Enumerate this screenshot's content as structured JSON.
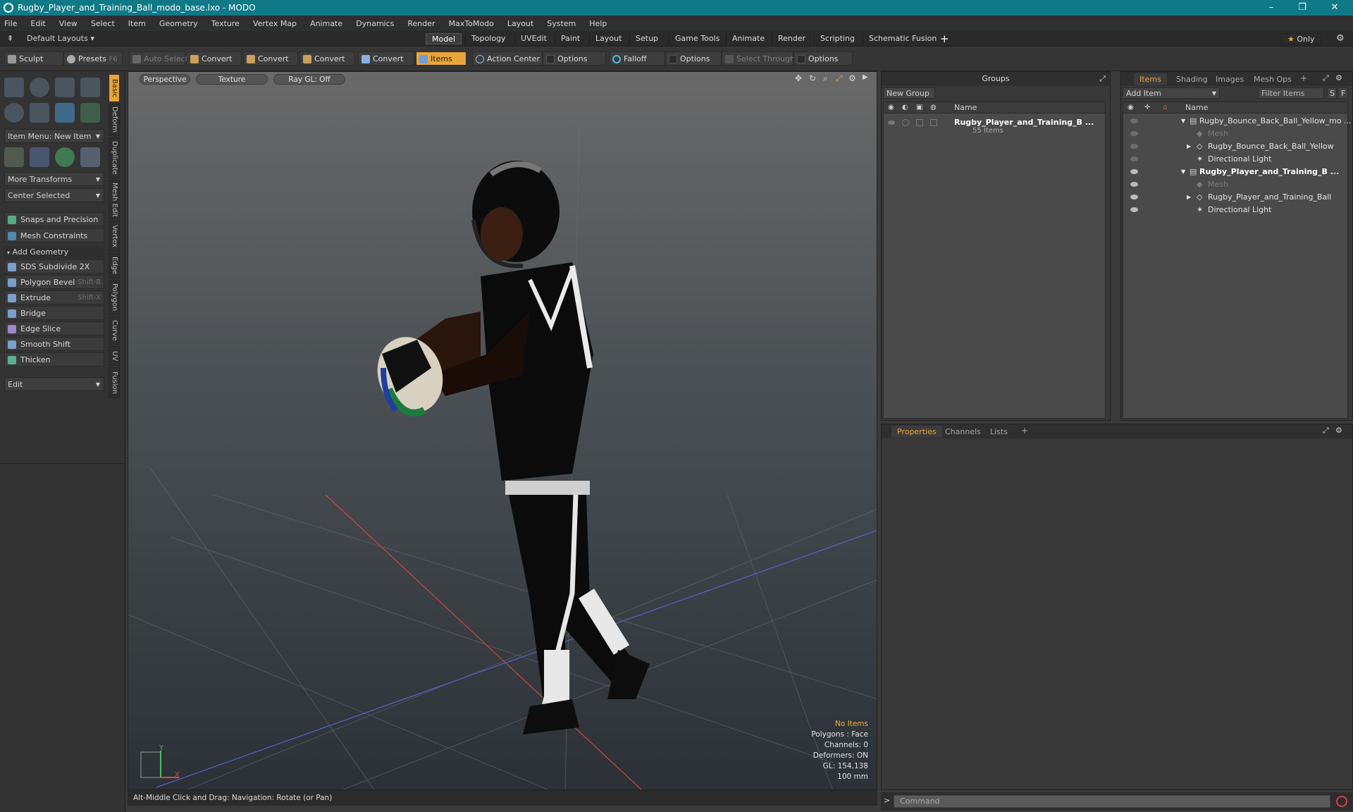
{
  "window": {
    "title": "Rugby_Player_and_Training_Ball_modo_base.lxo - MODO",
    "controls": [
      "–",
      "❐",
      "✕"
    ]
  },
  "menu": [
    "File",
    "Edit",
    "View",
    "Select",
    "Item",
    "Geometry",
    "Texture",
    "Vertex Map",
    "Animate",
    "Dynamics",
    "Render",
    "MaxToModo",
    "Layout",
    "System",
    "Help"
  ],
  "layout_row": {
    "layout_name": "Default Layouts",
    "tabs": [
      "Model",
      "Topology",
      "UVEdit",
      "Paint",
      "Layout",
      "Setup",
      "Game Tools",
      "Animate",
      "Render",
      "Scripting",
      "Schematic Fusion"
    ],
    "active_tab": "Model",
    "add": "+",
    "only": "Only"
  },
  "toolbar": {
    "sculpt": "Sculpt",
    "presets": "Presets",
    "presets_key": "F6",
    "auto_select": "Auto Select",
    "convert1": "Convert",
    "convert2": "Convert",
    "convert3": "Convert",
    "convert4": "Convert",
    "items": "Items",
    "action_center": "Action Center",
    "options1": "Options",
    "falloff": "Falloff",
    "options2": "Options",
    "select_through": "Select Through",
    "options3": "Options"
  },
  "left_panel": {
    "item_menu": "Item Menu: New Item",
    "more_transforms": "More Transforms",
    "center_selected": "Center Selected",
    "snaps": "Snaps and Precision",
    "mesh_constraints": "Mesh Constraints",
    "add_geometry": "Add Geometry",
    "tools": [
      {
        "label": "SDS Subdivide 2X",
        "key": ""
      },
      {
        "label": "Polygon Bevel",
        "key": "Shift-B"
      },
      {
        "label": "Extrude",
        "key": "Shift-X"
      },
      {
        "label": "Bridge",
        "key": ""
      },
      {
        "label": "Edge Slice",
        "key": ""
      },
      {
        "label": "Smooth Shift",
        "key": ""
      },
      {
        "label": "Thicken",
        "key": ""
      }
    ],
    "edit": "Edit",
    "vtabs": [
      "Basic",
      "Deform",
      "Duplicate",
      "Mesh Edit",
      "Vertex",
      "Edge",
      "Polygon",
      "Curve",
      "UV",
      "Fusion"
    ]
  },
  "viewport": {
    "perspective": "Perspective",
    "texture": "Texture",
    "raygl": "Ray GL: Off",
    "info": {
      "no_items": "No Items",
      "polygons": "Polygons : Face",
      "channels": "Channels: 0",
      "deformers": "Deformers: ON",
      "gl": "GL: 154,138",
      "scale": "100 mm"
    },
    "status": "Alt-Middle Click and Drag:   Navigation: Rotate (or Pan)"
  },
  "groups_panel": {
    "title": "Groups",
    "new_group": "New Group",
    "name_col": "Name",
    "group_name": "Rugby_Player_and_Training_B ...",
    "group_count": "55 Items"
  },
  "items_panel": {
    "tabs": [
      "Items",
      "Shading",
      "Images",
      "Mesh Ops"
    ],
    "active_tab": "Items",
    "add_item": "Add Item",
    "filter": "Filter Items",
    "s": "S",
    "f": "F",
    "name_col": "Name",
    "rows": [
      {
        "label": "Rugby_Bounce_Back_Ball_Yellow_mo ...",
        "style": "normal",
        "indent": 0
      },
      {
        "label": "Mesh",
        "style": "dim",
        "indent": 1
      },
      {
        "label": "Rugby_Bounce_Back_Ball_Yellow",
        "style": "normal",
        "indent": 1
      },
      {
        "label": "Directional Light",
        "style": "normal",
        "indent": 1
      },
      {
        "label": "Rugby_Player_and_Training_B ...",
        "style": "bold",
        "indent": 0
      },
      {
        "label": "Mesh",
        "style": "dim",
        "indent": 1
      },
      {
        "label": "Rugby_Player_and_Training_Ball",
        "style": "normal",
        "indent": 1
      },
      {
        "label": "Directional Light",
        "style": "normal",
        "indent": 1
      }
    ]
  },
  "props_panel": {
    "tabs": [
      "Properties",
      "Channels",
      "Lists"
    ],
    "active_tab": "Properties"
  },
  "command": {
    "placeholder": "Command"
  },
  "colors": {
    "accent": "#e9a53a",
    "titlebar": "#0f7a86"
  }
}
